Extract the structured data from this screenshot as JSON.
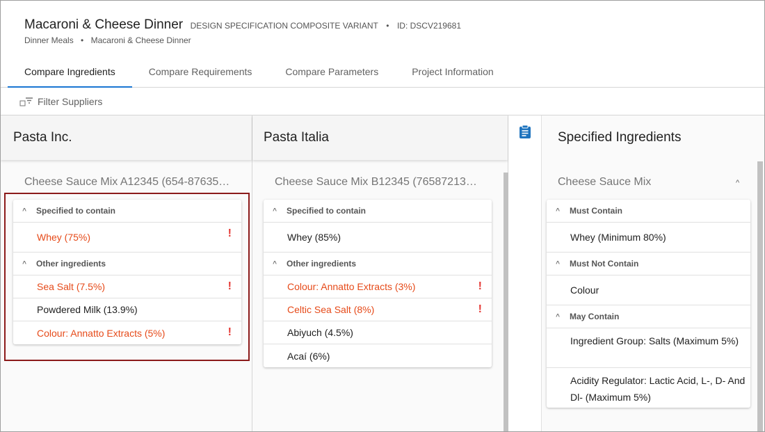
{
  "header": {
    "title": "Macaroni & Cheese Dinner",
    "subtitle": "DESIGN SPECIFICATION COMPOSITE VARIANT",
    "id_label": "ID: DSCV219681",
    "breadcrumbs": [
      "Dinner Meals",
      "Macaroni & Cheese Dinner"
    ]
  },
  "tabs": [
    {
      "label": "Compare Ingredients",
      "active": true
    },
    {
      "label": "Compare Requirements",
      "active": false
    },
    {
      "label": "Compare Parameters",
      "active": false
    },
    {
      "label": "Project Information",
      "active": false
    }
  ],
  "filter": {
    "label": "Filter Suppliers"
  },
  "suppliers": [
    {
      "name": "Pasta Inc.",
      "product": "Cheese Sauce Mix A12345 (654-87635…",
      "specified_header": "Specified to contain",
      "specified": [
        {
          "text": "Whey (75%)",
          "warn": true
        }
      ],
      "other_header": "Other ingredients",
      "other": [
        {
          "text": "Sea Salt (7.5%)",
          "warn": true
        },
        {
          "text": "Powdered Milk (13.9%)",
          "warn": false
        },
        {
          "text": "Colour: Annatto Extracts (5%)",
          "warn": true
        }
      ]
    },
    {
      "name": "Pasta Italia",
      "product": "Cheese Sauce Mix B12345 (76587213…",
      "specified_header": "Specified to contain",
      "specified": [
        {
          "text": "Whey (85%)",
          "warn": false
        }
      ],
      "other_header": "Other ingredients",
      "other": [
        {
          "text": "Colour: Annatto Extracts (3%)",
          "warn": true
        },
        {
          "text": "Celtic Sea Salt (8%)",
          "warn": true
        },
        {
          "text": "Abiyuch (4.5%)",
          "warn": false
        },
        {
          "text": "Acaí (6%)",
          "warn": false
        }
      ]
    }
  ],
  "specified": {
    "title": "Specified Ingredients",
    "group": "Cheese Sauce Mix",
    "must_contain_header": "Must Contain",
    "must_contain": [
      "Whey (Minimum 80%)"
    ],
    "must_not_contain_header": "Must Not Contain",
    "must_not_contain": [
      "Colour"
    ],
    "may_contain_header": "May Contain",
    "may_contain": [
      "Ingredient Group: Salts (Maximum 5%)",
      "Acidity Regulator: Lactic Acid, L-, D- And Dl- (Maximum 5%)"
    ]
  },
  "warn_symbol": "!",
  "colors": {
    "accent": "#1976d2",
    "warning": "#e64a19",
    "highlight": "#8b1a1a"
  }
}
